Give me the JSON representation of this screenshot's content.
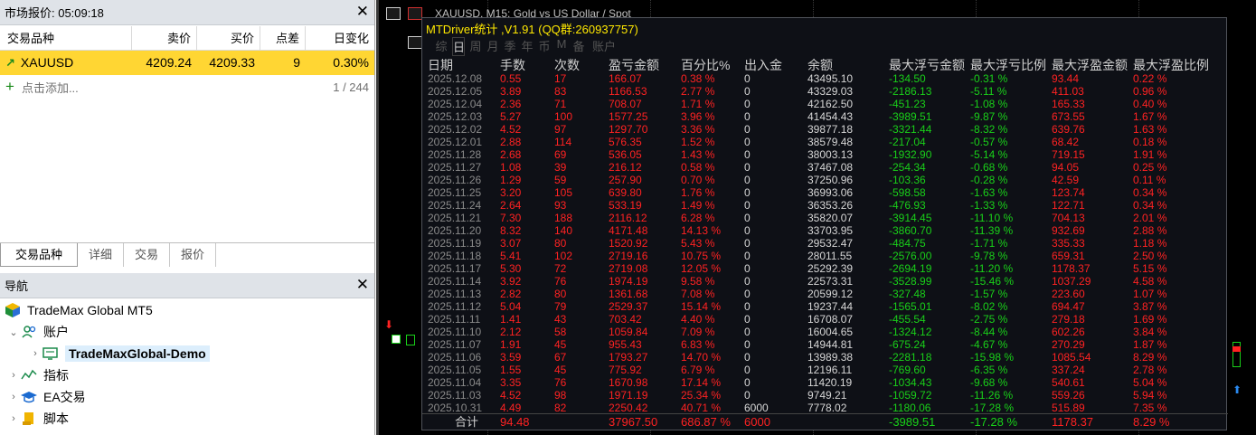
{
  "market_watch": {
    "title": "市场报价: 05:09:18",
    "columns": [
      "交易品种",
      "卖价",
      "买价",
      "点差",
      "日变化"
    ],
    "rows": [
      {
        "symbol": "XAUUSD",
        "bid": "4209.24",
        "ask": "4209.33",
        "spread": "9",
        "change": "0.30%"
      }
    ],
    "add_label": "点击添加...",
    "count": "1 / 244",
    "tabs": [
      "交易品种",
      "详细",
      "交易",
      "报价"
    ]
  },
  "navigator": {
    "title": "导航",
    "items": [
      "TradeMax Global MT5",
      "账户",
      "TradeMaxGlobal-Demo",
      "指标",
      "EA交易",
      "脚本"
    ]
  },
  "chart_title_partial": "XAUUSD, M15:  Gold vs US Dollar / Spot",
  "stats": {
    "title": "MTDriver统计 ,V1.91 (QQ群:260937757)",
    "period_tabs": [
      "综",
      "日",
      "周",
      "月",
      "季",
      "年",
      "币",
      "M",
      "备",
      "账户"
    ],
    "columns": [
      "日期",
      "手数",
      "次数",
      "盈亏金额",
      "百分比%",
      "出入金",
      "余额",
      "最大浮亏金额",
      "最大浮亏比例",
      "最大浮盈金额",
      "最大浮盈比例"
    ],
    "rows": [
      [
        "2025.12.08",
        "0.55",
        "17",
        "166.07",
        "0.38 %",
        "0",
        "43495.10",
        "-134.50",
        "-0.31 %",
        "93.44",
        "0.22 %"
      ],
      [
        "2025.12.05",
        "3.89",
        "83",
        "1166.53",
        "2.77 %",
        "0",
        "43329.03",
        "-2186.13",
        "-5.11 %",
        "411.03",
        "0.96 %"
      ],
      [
        "2025.12.04",
        "2.36",
        "71",
        "708.07",
        "1.71 %",
        "0",
        "42162.50",
        "-451.23",
        "-1.08 %",
        "165.33",
        "0.40 %"
      ],
      [
        "2025.12.03",
        "5.27",
        "100",
        "1577.25",
        "3.96 %",
        "0",
        "41454.43",
        "-3989.51",
        "-9.87 %",
        "673.55",
        "1.67 %"
      ],
      [
        "2025.12.02",
        "4.52",
        "97",
        "1297.70",
        "3.36 %",
        "0",
        "39877.18",
        "-3321.44",
        "-8.32 %",
        "639.76",
        "1.63 %"
      ],
      [
        "2025.12.01",
        "2.88",
        "114",
        "576.35",
        "1.52 %",
        "0",
        "38579.48",
        "-217.04",
        "-0.57 %",
        "68.42",
        "0.18 %"
      ],
      [
        "2025.11.28",
        "2.68",
        "69",
        "536.05",
        "1.43 %",
        "0",
        "38003.13",
        "-1932.90",
        "-5.14 %",
        "719.15",
        "1.91 %"
      ],
      [
        "2025.11.27",
        "1.08",
        "39",
        "216.12",
        "0.58 %",
        "0",
        "37467.08",
        "-254.34",
        "-0.68 %",
        "94.05",
        "0.25 %"
      ],
      [
        "2025.11.26",
        "1.29",
        "59",
        "257.90",
        "0.70 %",
        "0",
        "37250.96",
        "-103.36",
        "-0.28 %",
        "42.59",
        "0.11 %"
      ],
      [
        "2025.11.25",
        "3.20",
        "105",
        "639.80",
        "1.76 %",
        "0",
        "36993.06",
        "-598.58",
        "-1.63 %",
        "123.74",
        "0.34 %"
      ],
      [
        "2025.11.24",
        "2.64",
        "93",
        "533.19",
        "1.49 %",
        "0",
        "36353.26",
        "-476.93",
        "-1.33 %",
        "122.71",
        "0.34 %"
      ],
      [
        "2025.11.21",
        "7.30",
        "188",
        "2116.12",
        "6.28 %",
        "0",
        "35820.07",
        "-3914.45",
        "-11.10 %",
        "704.13",
        "2.01 %"
      ],
      [
        "2025.11.20",
        "8.32",
        "140",
        "4171.48",
        "14.13 %",
        "0",
        "33703.95",
        "-3860.70",
        "-11.39 %",
        "932.69",
        "2.88 %"
      ],
      [
        "2025.11.19",
        "3.07",
        "80",
        "1520.92",
        "5.43 %",
        "0",
        "29532.47",
        "-484.75",
        "-1.71 %",
        "335.33",
        "1.18 %"
      ],
      [
        "2025.11.18",
        "5.41",
        "102",
        "2719.16",
        "10.75 %",
        "0",
        "28011.55",
        "-2576.00",
        "-9.78 %",
        "659.31",
        "2.50 %"
      ],
      [
        "2025.11.17",
        "5.30",
        "72",
        "2719.08",
        "12.05 %",
        "0",
        "25292.39",
        "-2694.19",
        "-11.20 %",
        "1178.37",
        "5.15 %"
      ],
      [
        "2025.11.14",
        "3.92",
        "76",
        "1974.19",
        "9.58 %",
        "0",
        "22573.31",
        "-3528.99",
        "-15.46 %",
        "1037.29",
        "4.58 %"
      ],
      [
        "2025.11.13",
        "2.82",
        "80",
        "1361.68",
        "7.08 %",
        "0",
        "20599.12",
        "-327.48",
        "-1.57 %",
        "223.60",
        "1.07 %"
      ],
      [
        "2025.11.12",
        "5.04",
        "79",
        "2529.37",
        "15.14 %",
        "0",
        "19237.44",
        "-1565.01",
        "-8.02 %",
        "694.47",
        "3.87 %"
      ],
      [
        "2025.11.11",
        "1.41",
        "43",
        "703.42",
        "4.40 %",
        "0",
        "16708.07",
        "-455.54",
        "-2.75 %",
        "279.18",
        "1.69 %"
      ],
      [
        "2025.11.10",
        "2.12",
        "58",
        "1059.84",
        "7.09 %",
        "0",
        "16004.65",
        "-1324.12",
        "-8.44 %",
        "602.26",
        "3.84 %"
      ],
      [
        "2025.11.07",
        "1.91",
        "45",
        "955.43",
        "6.83 %",
        "0",
        "14944.81",
        "-675.24",
        "-4.67 %",
        "270.29",
        "1.87 %"
      ],
      [
        "2025.11.06",
        "3.59",
        "67",
        "1793.27",
        "14.70 %",
        "0",
        "13989.38",
        "-2281.18",
        "-15.98 %",
        "1085.54",
        "8.29 %"
      ],
      [
        "2025.11.05",
        "1.55",
        "45",
        "775.92",
        "6.79 %",
        "0",
        "12196.11",
        "-769.60",
        "-6.35 %",
        "337.24",
        "2.78 %"
      ],
      [
        "2025.11.04",
        "3.35",
        "76",
        "1670.98",
        "17.14 %",
        "0",
        "11420.19",
        "-1034.43",
        "-9.68 %",
        "540.61",
        "5.04 %"
      ],
      [
        "2025.11.03",
        "4.52",
        "98",
        "1971.19",
        "25.34 %",
        "0",
        "9749.21",
        "-1059.72",
        "-11.26 %",
        "559.26",
        "5.94 %"
      ],
      [
        "2025.10.31",
        "4.49",
        "82",
        "2250.42",
        "40.71 %",
        "6000",
        "7778.02",
        "-1180.06",
        "-17.28 %",
        "515.89",
        "7.35 %"
      ]
    ],
    "total": [
      "合计",
      "94.48",
      "37967.50",
      "686.87 %",
      "6000",
      "-3989.51",
      "-17.28 %",
      "1178.37",
      "8.29 %"
    ]
  },
  "colors": {
    "stats_title": "#ffe800",
    "positive": "#ff2222",
    "negative": "#19d019",
    "selected_row": "#ffd633"
  }
}
